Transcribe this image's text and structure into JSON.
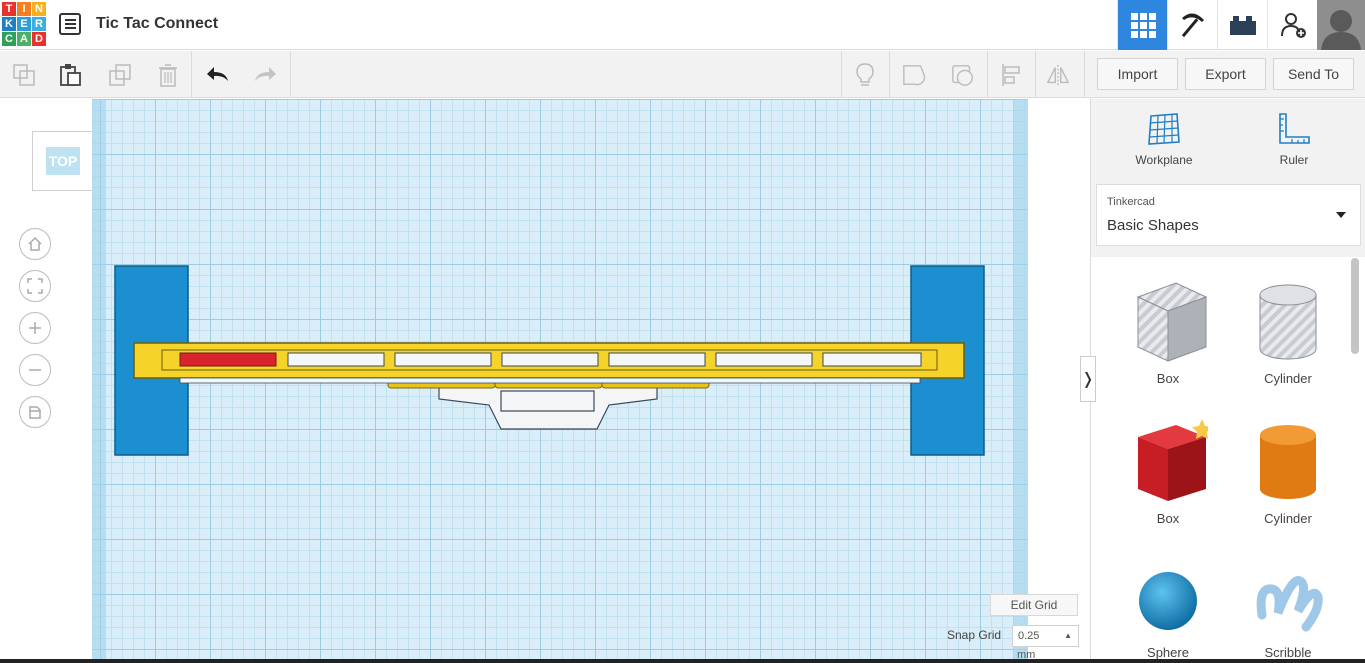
{
  "app": {
    "title": "Tic Tac Connect",
    "logo_letters": [
      "T",
      "I",
      "N",
      "K",
      "E",
      "R",
      "C",
      "A",
      "D"
    ],
    "logo_colors": [
      "#e8322d",
      "#f57f20",
      "#f6b01e",
      "#1f7fc4",
      "#2a9fd8",
      "#3bb0e0",
      "#2fa05a",
      "#49b267",
      "#e8322d"
    ]
  },
  "topbar_icons": [
    "grid-view-icon",
    "pickaxe-icon",
    "bricks-icon",
    "add-user-icon",
    "avatar"
  ],
  "toolbar": {
    "import_label": "Import",
    "export_label": "Export",
    "sendto_label": "Send To"
  },
  "viewcube": {
    "face_label": "TOP"
  },
  "grid": {
    "edit_label": "Edit Grid",
    "snap_label": "Snap Grid",
    "snap_value": "0.25",
    "snap_unit": "mm"
  },
  "panel": {
    "workplane_label": "Workplane",
    "ruler_label": "Ruler",
    "library_small": "Tinkercad",
    "library_name": "Basic Shapes",
    "shapes": [
      {
        "label": "Box"
      },
      {
        "label": "Cylinder"
      },
      {
        "label": "Box"
      },
      {
        "label": "Cylinder"
      },
      {
        "label": "Sphere"
      },
      {
        "label": "Scribble"
      }
    ]
  },
  "colors": {
    "accent": "#2e86de",
    "blue_part": "#1b8fcf",
    "yellow_part": "#f5d328",
    "red_part": "#d8242c"
  }
}
